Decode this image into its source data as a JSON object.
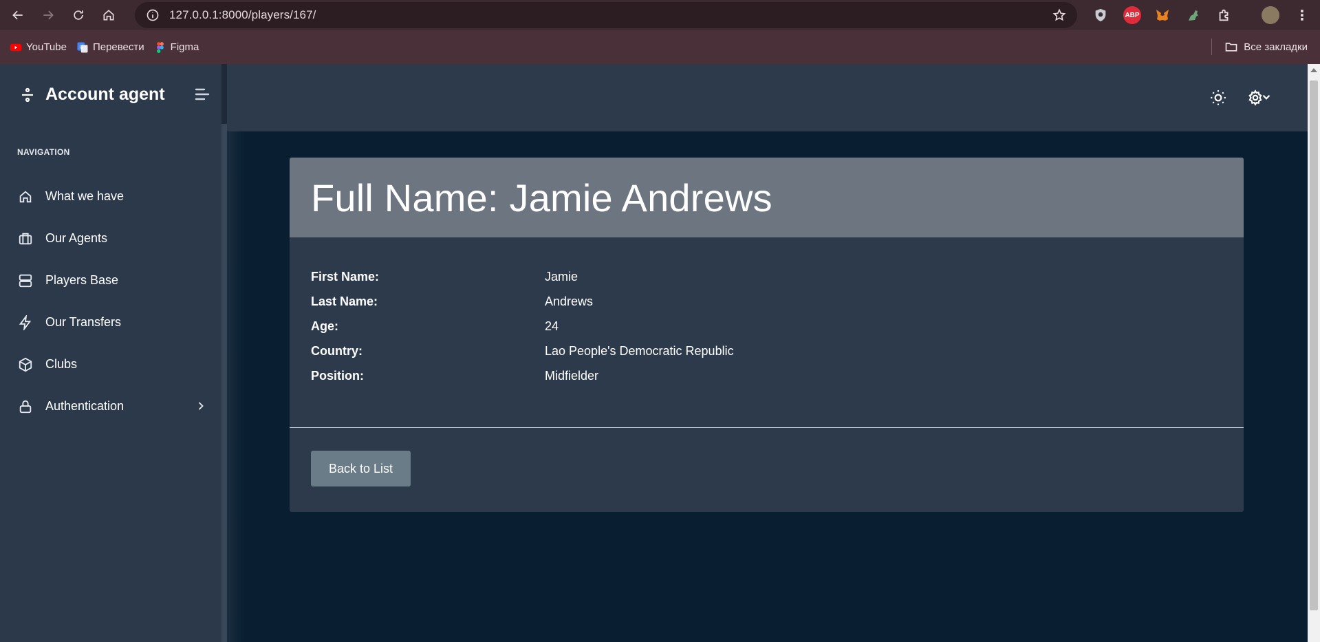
{
  "browser": {
    "url": "127.0.0.1:8000/players/167/",
    "bookmarks": [
      {
        "label": "YouTube",
        "icon": "youtube-icon"
      },
      {
        "label": "Перевести",
        "icon": "google-translate-icon"
      },
      {
        "label": "Figma",
        "icon": "figma-icon"
      }
    ],
    "all_bookmarks_label": "Все закладки",
    "extensions": [
      "shield-extension-icon",
      "adblock-extension-icon",
      "metamask-extension-icon",
      "dino-extension-icon",
      "extensions-puzzle-icon",
      "profile-avatar"
    ]
  },
  "sidebar": {
    "brand": "Account agent",
    "nav_heading": "NAVIGATION",
    "items": [
      {
        "label": "What we have",
        "icon": "home-icon"
      },
      {
        "label": "Our Agents",
        "icon": "briefcase-icon"
      },
      {
        "label": "Players Base",
        "icon": "server-icon"
      },
      {
        "label": "Our Transfers",
        "icon": "lightning-icon"
      },
      {
        "label": "Clubs",
        "icon": "box-icon"
      },
      {
        "label": "Authentication",
        "icon": "lock-icon"
      }
    ]
  },
  "card": {
    "title": "Full Name: Jamie Andrews",
    "fields": [
      {
        "label": "First Name:",
        "value": "Jamie"
      },
      {
        "label": "Last Name:",
        "value": "Andrews"
      },
      {
        "label": "Age:",
        "value": "24"
      },
      {
        "label": "Country:",
        "value": "Lao People's Democratic Republic"
      },
      {
        "label": "Position:",
        "value": "Midfielder"
      }
    ],
    "back_button": "Back to List"
  },
  "colors": {
    "sidebar_bg": "#2c394b",
    "main_bg": "#091e31",
    "card_header_bg": "#6c7580",
    "button_bg": "#6b7c89"
  }
}
